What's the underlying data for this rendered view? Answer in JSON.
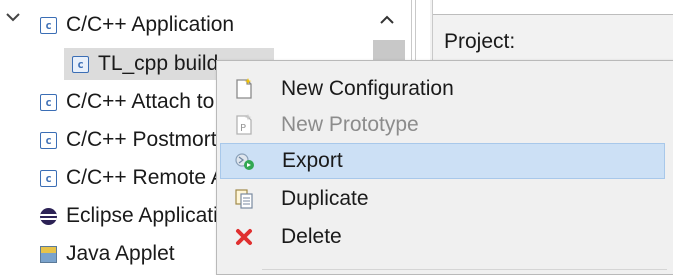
{
  "tree": {
    "items": [
      {
        "label": "C/C++ Application",
        "icon": "c-config-icon",
        "expanded": true
      },
      {
        "label": "TL_cpp build",
        "icon": "c-config-icon",
        "child": true,
        "selected": true
      },
      {
        "label": "C/C++ Attach to Application",
        "icon": "c-config-icon"
      },
      {
        "label": "C/C++ Postmortem Debugger",
        "icon": "c-config-icon"
      },
      {
        "label": "C/C++ Remote Application",
        "icon": "c-config-icon"
      },
      {
        "label": "Eclipse Application",
        "icon": "eclipse-icon"
      },
      {
        "label": "Java Applet",
        "icon": "applet-icon"
      }
    ]
  },
  "right_panel": {
    "project_label": "Project:"
  },
  "context_menu": {
    "items": [
      {
        "label": "New Configuration",
        "icon": "new-configuration-icon",
        "enabled": true
      },
      {
        "label": "New Prototype",
        "icon": "new-prototype-icon",
        "enabled": false
      },
      {
        "label": "Export",
        "icon": "export-icon",
        "enabled": true,
        "highlighted": true
      },
      {
        "label": "Duplicate",
        "icon": "duplicate-icon",
        "enabled": true
      },
      {
        "label": "Delete",
        "icon": "delete-icon",
        "enabled": true
      }
    ]
  },
  "colors": {
    "menu_highlight": "#cce0f5",
    "selection": "#dcdcdc",
    "delete_red": "#e03030",
    "config_blue": "#3b6eb5"
  }
}
